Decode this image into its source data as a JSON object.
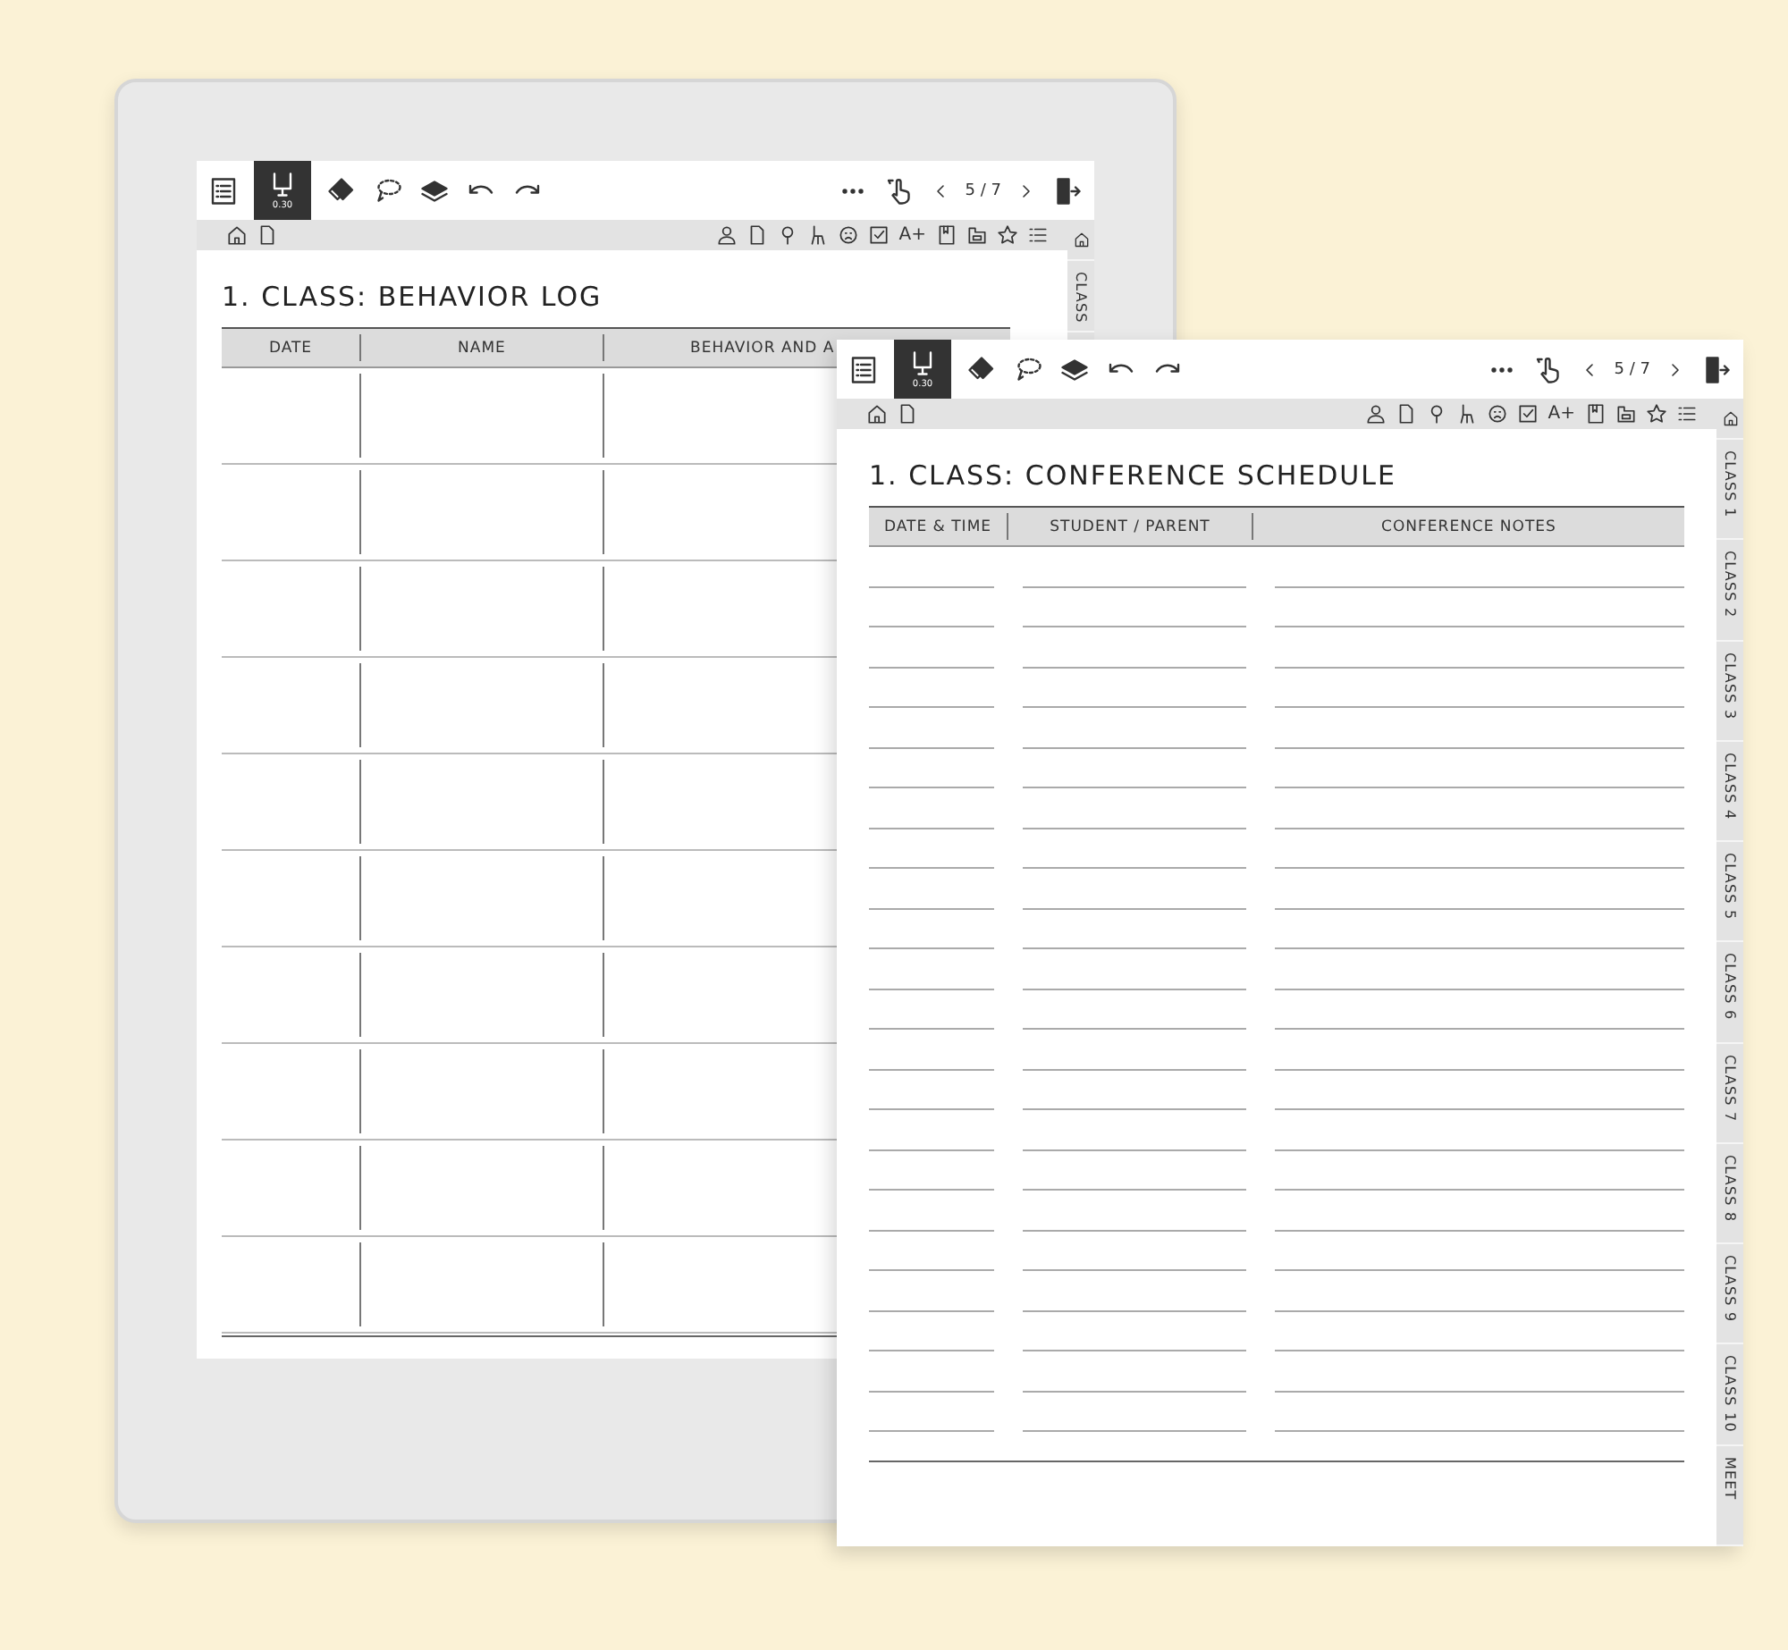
{
  "screens": [
    {
      "toolbar": {
        "pen_selected": true,
        "pen_size": "0.30",
        "page": "5 / 7"
      },
      "nav": {
        "text_size_label": "A+"
      },
      "title": "1. CLASS: BEHAVIOR LOG",
      "columns": [
        "DATE",
        "NAME",
        "BEHAVIOR AND A"
      ],
      "side_tabs": [
        "CLASS"
      ]
    },
    {
      "toolbar": {
        "pen_selected": true,
        "pen_size": "0.30",
        "page": "5 / 7"
      },
      "nav": {
        "text_size_label": "A+"
      },
      "title": "1. CLASS: CONFERENCE SCHEDULE",
      "columns": [
        "DATE & TIME",
        "STUDENT / PARENT",
        "CONFERENCE NOTES"
      ],
      "side_tabs": [
        "CLASS 1",
        "CLASS 2",
        "CLASS 3",
        "CLASS 4",
        "CLASS 5",
        "CLASS 6",
        "CLASS 7",
        "CLASS 8",
        "CLASS 9",
        "CLASS 10",
        "MEET"
      ]
    }
  ]
}
